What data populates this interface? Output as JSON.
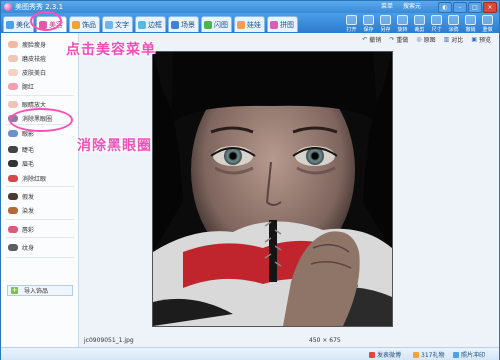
{
  "app": {
    "title": "美图秀秀 2.3.1"
  },
  "titlebar": {
    "links": [
      "菜单",
      "搜索元"
    ]
  },
  "tabs": [
    {
      "label": "美化",
      "color": "#4ca2e8"
    },
    {
      "label": "美容",
      "color": "#e458a8"
    },
    {
      "label": "饰品",
      "color": "#f2a338"
    },
    {
      "label": "文字",
      "color": "#6fb5ef"
    },
    {
      "label": "边框",
      "color": "#59b8e0"
    },
    {
      "label": "场景",
      "color": "#3f7fd6"
    },
    {
      "label": "闪图",
      "color": "#46b74a"
    },
    {
      "label": "娃娃",
      "color": "#f29b56"
    },
    {
      "label": "拼图",
      "color": "#d95fb6"
    }
  ],
  "toolbar": [
    "打开",
    "保存",
    "另存",
    "旋转",
    "裁剪",
    "尺寸",
    "涂鸦",
    "撤销",
    "重做"
  ],
  "sidebar": {
    "items": [
      {
        "label": "瘦脸瘦身",
        "color": "#f5b8a0"
      },
      {
        "label": "磨皮祛痘",
        "color": "#f1c5b1"
      },
      {
        "label": "皮肤美白",
        "color": "#f6d0c0"
      },
      {
        "label": "腮红",
        "color": "#f4a0a8"
      },
      {
        "label": "眼睛放大",
        "color": "#f2c3b2"
      },
      {
        "label": "消除黑眼圈",
        "color": "#8b7d9e"
      },
      {
        "label": "眼影",
        "color": "#6c8fd1"
      },
      {
        "label": "睫毛",
        "color": "#444444"
      },
      {
        "label": "眉毛",
        "color": "#333333"
      },
      {
        "label": "消除红眼",
        "color": "#d34848"
      },
      {
        "label": "假发",
        "color": "#4b3b2e"
      },
      {
        "label": "染发",
        "color": "#b5683a"
      },
      {
        "label": "唇彩",
        "color": "#e2577a"
      },
      {
        "label": "纹身",
        "color": "#5e5e5e"
      }
    ],
    "import_label": "导入饰品"
  },
  "editor": {
    "actions": [
      "撤销",
      "重做",
      "原图",
      "对比",
      "预览"
    ],
    "file_name": "jc0909051_1.jpg",
    "image_size": "450 × 675"
  },
  "bottom": {
    "items": [
      "发表微博",
      "317礼物",
      "照片冲印"
    ]
  },
  "annotations": {
    "step1": "点击美容菜单",
    "step2": "消除黑眼圈"
  }
}
